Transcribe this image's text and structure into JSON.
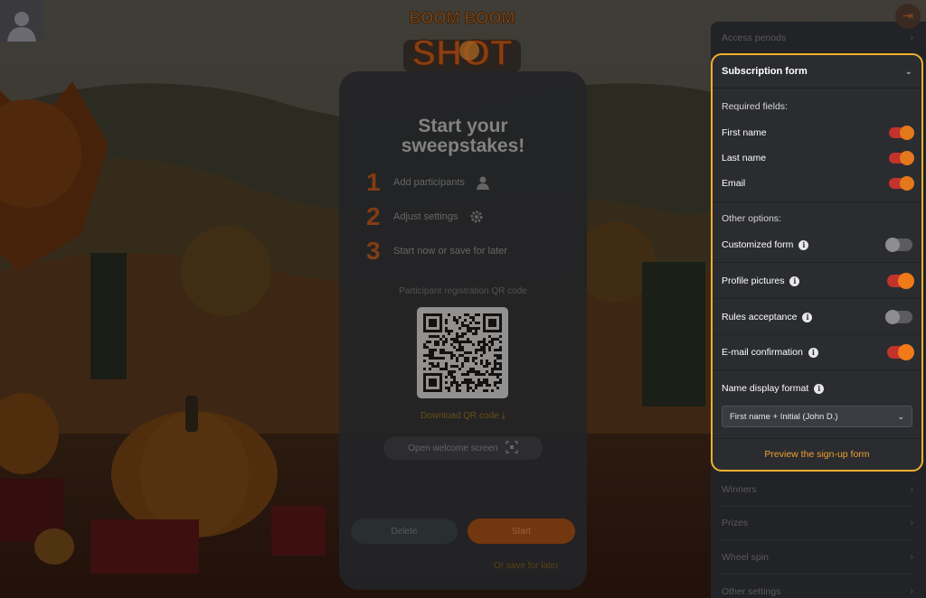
{
  "logo": {
    "line1": "BOOM BOOM",
    "line2": "SHOT"
  },
  "card": {
    "title": "Start your sweepstakes!",
    "steps": [
      {
        "num": "1",
        "label": "Add participants",
        "icon": "user-icon"
      },
      {
        "num": "2",
        "label": "Adjust settings",
        "icon": "gear-icon"
      },
      {
        "num": "3",
        "label": "Start now or save for later",
        "icon": ""
      }
    ],
    "qr_label": "Participant registration QR code",
    "download": "Download QR code",
    "welcome_button": "Open welcome screen",
    "delete_button": "Delete",
    "start_button": "Start",
    "save_later": "Or save for later"
  },
  "panel": {
    "dim_items_top": [
      "Access periods"
    ],
    "section": {
      "title": "Subscription form",
      "required_label": "Required fields:",
      "required": [
        {
          "label": "First name",
          "on": true
        },
        {
          "label": "Last name",
          "on": true
        },
        {
          "label": "Email",
          "on": true
        }
      ],
      "other_label": "Other options:",
      "options": [
        {
          "label": "Customized form",
          "on": false
        },
        {
          "label": "Profile pictures",
          "on": true
        },
        {
          "label": "Rules acceptance",
          "on": false
        },
        {
          "label": "E-mail confirmation",
          "on": true
        }
      ],
      "name_format_label": "Name display format",
      "name_format_value": "First name + Initial (John D.)",
      "preview_link": "Preview the sign-up form"
    },
    "dim_items_bottom": [
      "Winners",
      "Prizes",
      "Wheel spin",
      "Other settings"
    ]
  },
  "colors": {
    "accent": "#f0b030",
    "toggle_on_knob": "#f07a18",
    "toggle_on_track": "#c2332b",
    "panel_bg": "#2b2c30"
  }
}
